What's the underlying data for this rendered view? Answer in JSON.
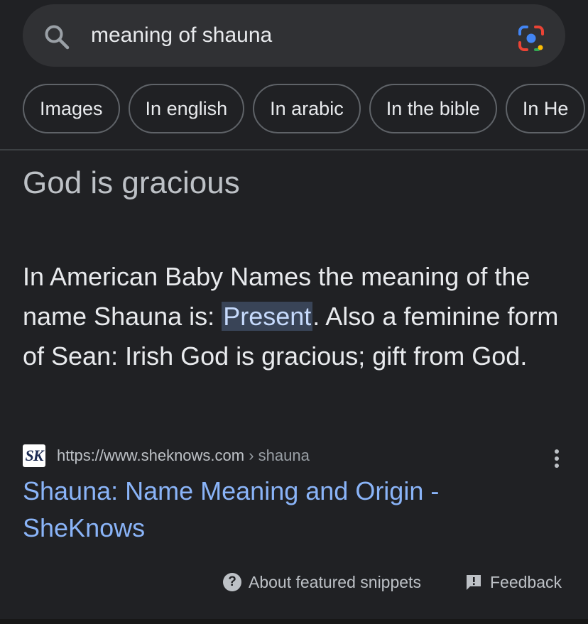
{
  "search": {
    "query": "meaning of shauna",
    "search_icon": "search-icon",
    "lens_icon": "google-lens-icon"
  },
  "chips": [
    {
      "label": "Images"
    },
    {
      "label": "In english"
    },
    {
      "label": "In arabic"
    },
    {
      "label": "In the bible"
    },
    {
      "label": "In He"
    }
  ],
  "featured_snippet": {
    "answer": "God is gracious",
    "text_before": "In American Baby Names the meaning of the name Shauna is: ",
    "highlight": "Present",
    "text_after": ". Also a feminine form of Sean: Irish God is gracious; gift from God."
  },
  "source": {
    "favicon_text": "SK",
    "url": "https://www.sheknows.com",
    "path": " › shauna",
    "title": "Shauna: Name Meaning and Origin - SheKnows",
    "menu_icon": "more-vert-icon"
  },
  "footer": {
    "about_label": "About featured snippets",
    "feedback_label": "Feedback",
    "about_icon": "help-icon",
    "feedback_icon": "feedback-icon"
  },
  "colors": {
    "background": "#202124",
    "link": "#8ab4f8",
    "highlight_bg": "#394457"
  }
}
